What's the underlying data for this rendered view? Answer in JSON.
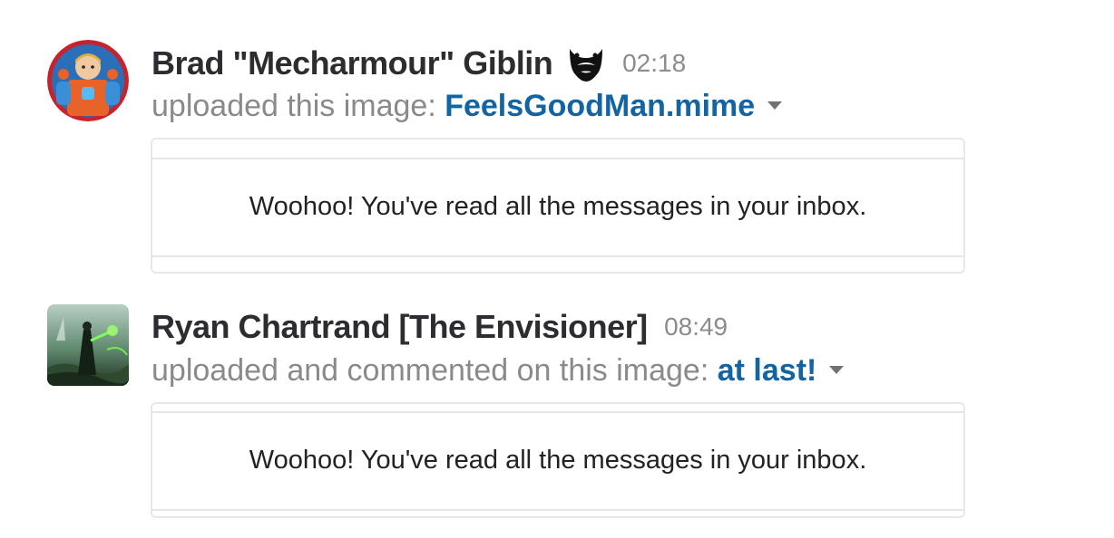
{
  "messages": [
    {
      "author": "Brad \"Mecharmour\" Giblin",
      "status_icon": "beard-emoji",
      "time": "02:18",
      "action": "uploaded this image: ",
      "file_name": "FeelsGoodMan.mime",
      "preview_text": "Woohoo! You've read all the messages in your inbox."
    },
    {
      "author": "Ryan Chartrand [The Envisioner]",
      "time": "08:49",
      "action": "uploaded and commented on this image: ",
      "file_name": "at last!",
      "preview_text": "Woohoo! You've read all the messages in your inbox."
    }
  ],
  "colors": {
    "link": "#1264a3",
    "author": "#2c2d30",
    "muted": "#8a8a8a"
  }
}
